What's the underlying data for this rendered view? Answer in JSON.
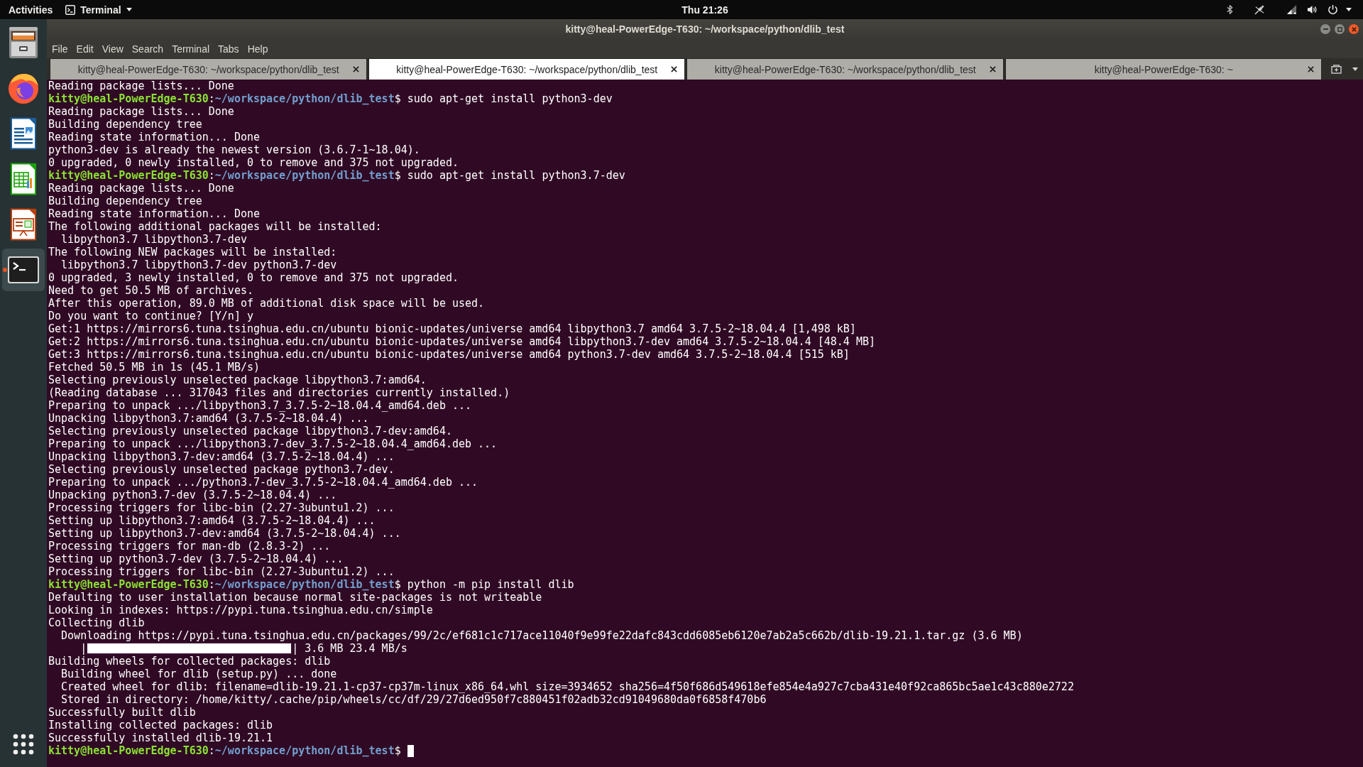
{
  "top_bar": {
    "activities": "Activities",
    "app_menu": "Terminal",
    "clock": "Thu 21:26"
  },
  "dock": {
    "items": [
      {
        "kind": "files",
        "active": false
      },
      {
        "kind": "browser",
        "active": false
      },
      {
        "kind": "document",
        "active": false
      },
      {
        "kind": "spreadsheet",
        "active": false
      },
      {
        "kind": "presentation",
        "active": false
      },
      {
        "kind": "terminal",
        "active": true
      }
    ]
  },
  "window": {
    "title": "kitty@heal-PowerEdge-T630: ~/workspace/python/dlib_test",
    "menu": [
      "File",
      "Edit",
      "View",
      "Search",
      "Terminal",
      "Tabs",
      "Help"
    ],
    "tabs": [
      {
        "title": "kitty@heal-PowerEdge-T630: ~/workspace/python/dlib_test",
        "selected": false
      },
      {
        "title": "kitty@heal-PowerEdge-T630: ~/workspace/python/dlib_test",
        "selected": true
      },
      {
        "title": "kitty@heal-PowerEdge-T630: ~/workspace/python/dlib_test",
        "selected": false
      },
      {
        "title": "kitty@heal-PowerEdge-T630: ~",
        "selected": false
      }
    ],
    "terminal": {
      "lines": [
        {
          "kind": "output",
          "text": "Reading package lists... Done"
        },
        {
          "kind": "prompt",
          "user": "kitty@heal-PowerEdge-T630",
          "sep": ":",
          "path": "~/workspace/python/dlib_test",
          "symbol": "$",
          "command": "sudo apt-get install python3-dev",
          "cursor": false
        },
        {
          "kind": "output",
          "text": "Reading package lists... Done"
        },
        {
          "kind": "output",
          "text": "Building dependency tree"
        },
        {
          "kind": "output",
          "text": "Reading state information... Done"
        },
        {
          "kind": "output",
          "text": "python3-dev is already the newest version (3.6.7-1~18.04)."
        },
        {
          "kind": "output",
          "text": "0 upgraded, 0 newly installed, 0 to remove and 375 not upgraded."
        },
        {
          "kind": "prompt",
          "user": "kitty@heal-PowerEdge-T630",
          "sep": ":",
          "path": "~/workspace/python/dlib_test",
          "symbol": "$",
          "command": "sudo apt-get install python3.7-dev",
          "cursor": false
        },
        {
          "kind": "output",
          "text": "Reading package lists... Done"
        },
        {
          "kind": "output",
          "text": "Building dependency tree"
        },
        {
          "kind": "output",
          "text": "Reading state information... Done"
        },
        {
          "kind": "output",
          "text": "The following additional packages will be installed:"
        },
        {
          "kind": "output",
          "text": "  libpython3.7 libpython3.7-dev"
        },
        {
          "kind": "output",
          "text": "The following NEW packages will be installed:"
        },
        {
          "kind": "output",
          "text": "  libpython3.7 libpython3.7-dev python3.7-dev"
        },
        {
          "kind": "output",
          "text": "0 upgraded, 3 newly installed, 0 to remove and 375 not upgraded."
        },
        {
          "kind": "output",
          "text": "Need to get 50.5 MB of archives."
        },
        {
          "kind": "output",
          "text": "After this operation, 89.0 MB of additional disk space will be used."
        },
        {
          "kind": "output",
          "text": "Do you want to continue? [Y/n] y"
        },
        {
          "kind": "output",
          "text": "Get:1 https://mirrors6.tuna.tsinghua.edu.cn/ubuntu bionic-updates/universe amd64 libpython3.7 amd64 3.7.5-2~18.04.4 [1,498 kB]"
        },
        {
          "kind": "output",
          "text": "Get:2 https://mirrors6.tuna.tsinghua.edu.cn/ubuntu bionic-updates/universe amd64 libpython3.7-dev amd64 3.7.5-2~18.04.4 [48.4 MB]"
        },
        {
          "kind": "output",
          "text": "Get:3 https://mirrors6.tuna.tsinghua.edu.cn/ubuntu bionic-updates/universe amd64 python3.7-dev amd64 3.7.5-2~18.04.4 [515 kB]"
        },
        {
          "kind": "output",
          "text": "Fetched 50.5 MB in 1s (45.1 MB/s)"
        },
        {
          "kind": "output",
          "text": "Selecting previously unselected package libpython3.7:amd64."
        },
        {
          "kind": "output",
          "text": "(Reading database ... 317043 files and directories currently installed.)"
        },
        {
          "kind": "output",
          "text": "Preparing to unpack .../libpython3.7_3.7.5-2~18.04.4_amd64.deb ..."
        },
        {
          "kind": "output",
          "text": "Unpacking libpython3.7:amd64 (3.7.5-2~18.04.4) ..."
        },
        {
          "kind": "output",
          "text": "Selecting previously unselected package libpython3.7-dev:amd64."
        },
        {
          "kind": "output",
          "text": "Preparing to unpack .../libpython3.7-dev_3.7.5-2~18.04.4_amd64.deb ..."
        },
        {
          "kind": "output",
          "text": "Unpacking libpython3.7-dev:amd64 (3.7.5-2~18.04.4) ..."
        },
        {
          "kind": "output",
          "text": "Selecting previously unselected package python3.7-dev."
        },
        {
          "kind": "output",
          "text": "Preparing to unpack .../python3.7-dev_3.7.5-2~18.04.4_amd64.deb ..."
        },
        {
          "kind": "output",
          "text": "Unpacking python3.7-dev (3.7.5-2~18.04.4) ..."
        },
        {
          "kind": "output",
          "text": "Processing triggers for libc-bin (2.27-3ubuntu1.2) ..."
        },
        {
          "kind": "output",
          "text": "Setting up libpython3.7:amd64 (3.7.5-2~18.04.4) ..."
        },
        {
          "kind": "output",
          "text": "Setting up libpython3.7-dev:amd64 (3.7.5-2~18.04.4) ..."
        },
        {
          "kind": "output",
          "text": "Processing triggers for man-db (2.8.3-2) ..."
        },
        {
          "kind": "output",
          "text": "Setting up python3.7-dev (3.7.5-2~18.04.4) ..."
        },
        {
          "kind": "output",
          "text": "Processing triggers for libc-bin (2.27-3ubuntu1.2) ..."
        },
        {
          "kind": "prompt",
          "user": "kitty@heal-PowerEdge-T630",
          "sep": ":",
          "path": "~/workspace/python/dlib_test",
          "symbol": "$",
          "command": "python -m pip install dlib",
          "cursor": false
        },
        {
          "kind": "output",
          "text": "Defaulting to user installation because normal site-packages is not writeable"
        },
        {
          "kind": "output",
          "text": "Looking in indexes: https://pypi.tuna.tsinghua.edu.cn/simple"
        },
        {
          "kind": "output",
          "text": "Collecting dlib"
        },
        {
          "kind": "output",
          "text": "  Downloading https://pypi.tuna.tsinghua.edu.cn/packages/99/2c/ef681c1c717ace11040f9e99fe22dafc843cdd6085eb6120e7ab2a5c662b/dlib-19.21.1.tar.gz (3.6 MB)"
        },
        {
          "kind": "progress",
          "lead": "     |",
          "level": 1,
          "tail": "| 3.6 MB 23.4 MB/s"
        },
        {
          "kind": "output",
          "text": "Building wheels for collected packages: dlib"
        },
        {
          "kind": "output",
          "text": "  Building wheel for dlib (setup.py) ... done"
        },
        {
          "kind": "output",
          "text": "  Created wheel for dlib: filename=dlib-19.21.1-cp37-cp37m-linux_x86_64.whl size=3934652 sha256=4f50f686d549618efe854e4a927c7cba431e40f92ca865bc5ae1c43c880e2722"
        },
        {
          "kind": "output",
          "text": "  Stored in directory: /home/kitty/.cache/pip/wheels/cc/df/29/27d6ed950f7c880451f02adb32cd91049680da0f6858f470b6"
        },
        {
          "kind": "output",
          "text": "Successfully built dlib"
        },
        {
          "kind": "output",
          "text": "Installing collected packages: dlib"
        },
        {
          "kind": "output",
          "text": "Successfully installed dlib-19.21.1"
        },
        {
          "kind": "prompt",
          "user": "kitty@heal-PowerEdge-T630",
          "sep": ":",
          "path": "~/workspace/python/dlib_test",
          "symbol": "$",
          "cursor": true
        }
      ]
    }
  }
}
